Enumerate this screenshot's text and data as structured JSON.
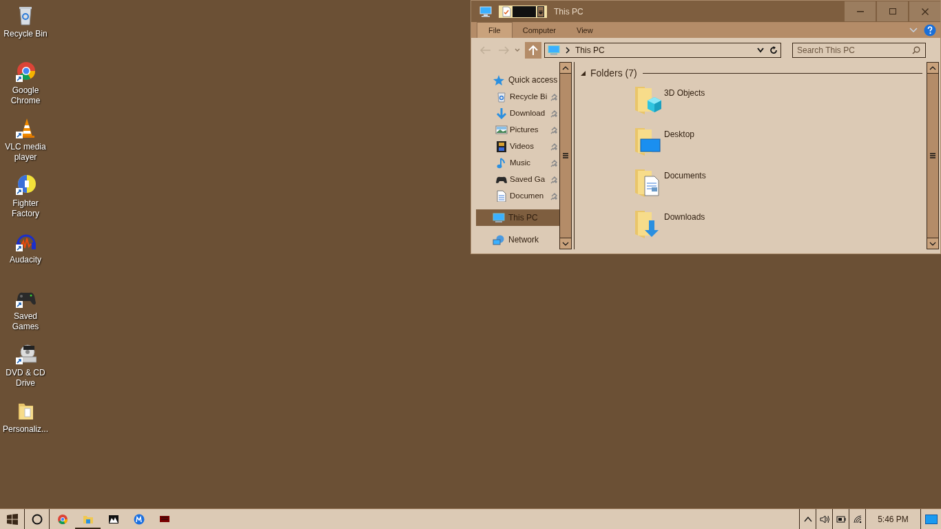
{
  "desktop_icons": [
    {
      "label": "Recycle Bin"
    },
    {
      "label": "Google Chrome"
    },
    {
      "label": "VLC media player"
    },
    {
      "label": "Fighter Factory"
    },
    {
      "label": "Audacity"
    },
    {
      "label": "Saved Games"
    },
    {
      "label": "DVD & CD Drive"
    },
    {
      "label": "Personaliz..."
    }
  ],
  "window": {
    "title": "This PC",
    "ribbon_tabs": [
      {
        "label": "File",
        "selected": true
      },
      {
        "label": "Computer",
        "selected": false
      },
      {
        "label": "View",
        "selected": false
      }
    ],
    "address": {
      "path": "This PC"
    },
    "search": {
      "placeholder": "Search This PC"
    },
    "nav_pane": [
      {
        "label": "Quick access",
        "selected": false,
        "children": [
          {
            "label": "Recycle Bi",
            "pinned": true
          },
          {
            "label": "Download",
            "pinned": true
          },
          {
            "label": "Pictures",
            "pinned": true
          },
          {
            "label": "Videos",
            "pinned": true
          },
          {
            "label": "Music",
            "pinned": true
          },
          {
            "label": "Saved Ga",
            "pinned": true
          },
          {
            "label": "Documen",
            "pinned": true
          }
        ]
      },
      {
        "label": "This PC",
        "selected": true
      },
      {
        "label": "Network",
        "selected": false
      }
    ],
    "group": {
      "title": "Folders (7)",
      "expanded": true
    },
    "folders": [
      {
        "name": "3D Objects"
      },
      {
        "name": "Desktop"
      },
      {
        "name": "Documents"
      },
      {
        "name": "Downloads"
      }
    ]
  },
  "taskbar": {
    "apps": [
      {
        "active": false
      },
      {
        "active": true
      },
      {
        "active": false
      },
      {
        "active": false
      },
      {
        "active": false
      }
    ],
    "clock": "5:46 PM"
  }
}
